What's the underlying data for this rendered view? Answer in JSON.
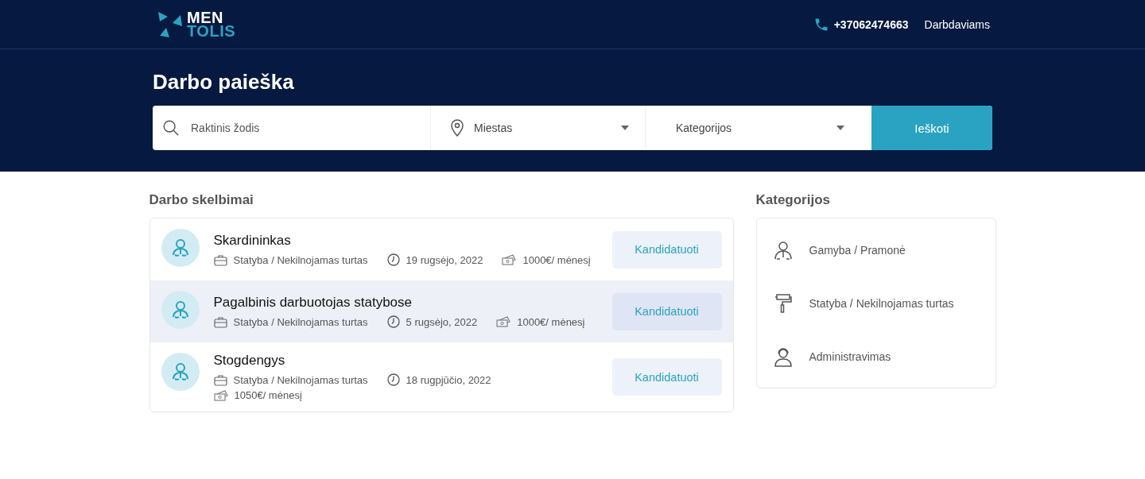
{
  "header": {
    "logo_top": "MEN",
    "logo_bottom": "TOLIS",
    "phone": "+37062474663",
    "nav_link": "Darbdaviams"
  },
  "search": {
    "title": "Darbo paieška",
    "keyword_placeholder": "Raktinis žodis",
    "city": "Miestas",
    "category": "Kategorijos",
    "button": "Ieškoti"
  },
  "jobs": {
    "title": "Darbo skelbimai",
    "items": [
      {
        "title": "Skardininkas",
        "category": "Statyba / Nekilnojamas turtas",
        "date": "19 rugsėjo, 2022",
        "salary": "1000€/ mėnesį",
        "button": "Kandidatuoti",
        "highlighted": false
      },
      {
        "title": "Pagalbinis darbuotojas statybose",
        "category": "Statyba / Nekilnojamas turtas",
        "date": "5 rugsėjo, 2022",
        "salary": "1000€/ mėnesį",
        "button": "Kandidatuoti",
        "highlighted": true
      },
      {
        "title": "Stogdengys",
        "category": "Statyba / Nekilnojamas turtas",
        "date": "18 rugpjūčio, 2022",
        "salary": "1050€/ mėnesį",
        "button": "Kandidatuoti",
        "highlighted": false
      }
    ]
  },
  "categories": {
    "title": "Kategorijos",
    "items": [
      {
        "label": "Gamyba / Pramonė",
        "kind": "worker"
      },
      {
        "label": "Statyba / Nekilnojamas turtas",
        "kind": "roller"
      },
      {
        "label": "Administravimas",
        "kind": "agent"
      }
    ]
  }
}
